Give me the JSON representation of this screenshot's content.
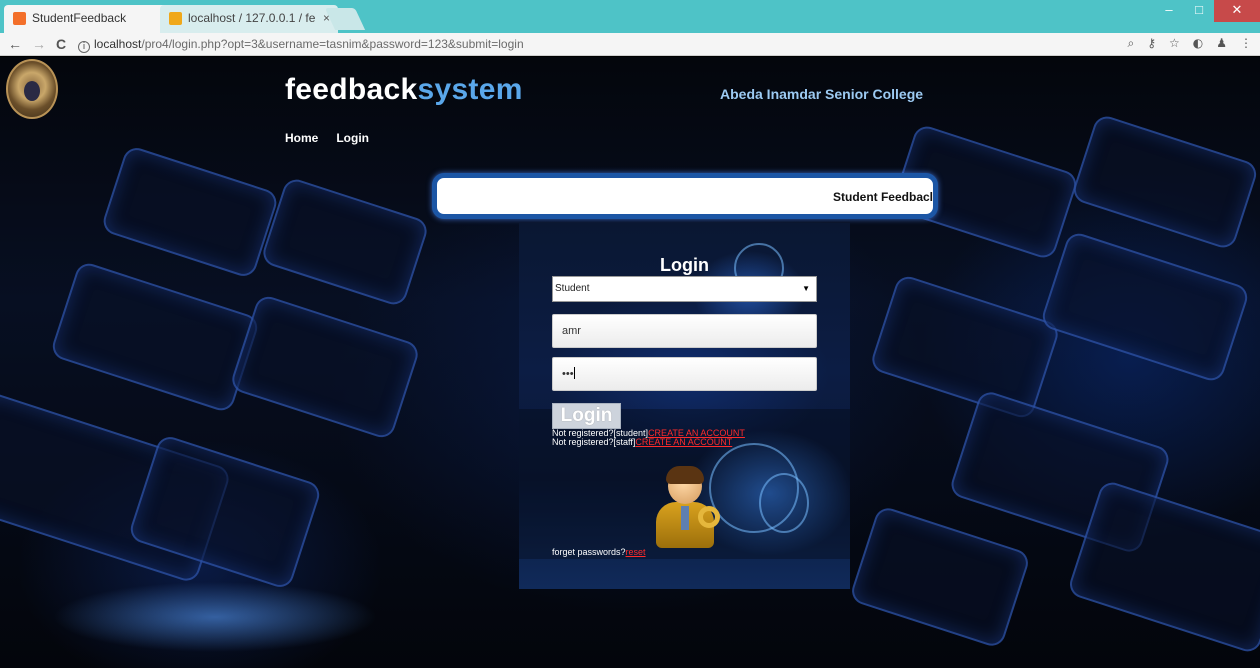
{
  "browser": {
    "tabs": [
      {
        "title": "StudentFeedback",
        "close": "×",
        "active": true
      },
      {
        "title": "localhost / 127.0.0.1 / fe",
        "close": "×",
        "active": false
      }
    ],
    "window_controls": {
      "minimize": "–",
      "maximize": "□",
      "close": "✕"
    },
    "nav": {
      "back": "←",
      "forward": "→",
      "reload": "C"
    },
    "url": {
      "host": "localhost",
      "path": "/pro4/login.php?opt=3&username=tasnim&password=123&submit=login"
    },
    "toolbar_icons": [
      "zoom-icon",
      "key-icon",
      "star-icon",
      "extension-icon",
      "incognito-icon",
      "menu-icon"
    ]
  },
  "site": {
    "brand_part1": "feedback",
    "brand_part2": "system",
    "college": "Abeda Inamdar Senior College",
    "menu": [
      "Home",
      "Login"
    ],
    "marquee": "Student Feedbacl"
  },
  "login": {
    "title": "Login",
    "role_select": {
      "selected": "Student"
    },
    "username_value": "amr",
    "password_mask": "•••",
    "button": "Login",
    "register_student_prefix": "Not registered?[student]",
    "register_student_link": "CREATE AN ACCOUNT",
    "register_staff_prefix": "Not registered?[staff]",
    "register_staff_link": "CREATE AN ACCOUNT",
    "forgot_prefix": "forget passwords?",
    "forgot_link": "reset"
  },
  "colors": {
    "tabstrip": "#4ec3c7",
    "brand_blue": "#5aa7ea",
    "college_text": "#9ccaf2",
    "link_red": "#ff2b2b",
    "marquee_border": "#1c56a5"
  }
}
